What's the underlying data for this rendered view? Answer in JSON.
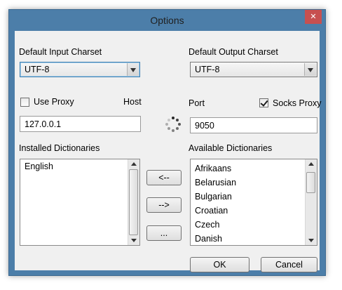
{
  "window": {
    "title": "Options",
    "close_glyph": "✕"
  },
  "input_charset": {
    "label": "Default Input Charset",
    "value": "UTF-8"
  },
  "output_charset": {
    "label": "Default Output Charset",
    "value": "UTF-8"
  },
  "proxy": {
    "use_proxy_label": "Use Proxy",
    "use_proxy_checked": false,
    "host_label": "Host",
    "host_value": "127.0.0.1",
    "port_label": "Port",
    "port_value": "9050",
    "socks_label": "Socks Proxy",
    "socks_checked": true
  },
  "installed": {
    "label": "Installed Dictionaries",
    "items": [
      "English"
    ]
  },
  "available": {
    "label": "Available Dictionaries",
    "items": [
      "Afrikaans",
      "Belarusian",
      "Bulgarian",
      "Croatian",
      "Czech",
      "Danish"
    ]
  },
  "transfer_buttons": {
    "add": "<--",
    "remove": "-->",
    "more": "..."
  },
  "footer": {
    "ok": "OK",
    "cancel": "Cancel"
  },
  "colors": {
    "frame": "#4c7ea9",
    "close": "#c75050",
    "client": "#f0f0f0"
  },
  "icons": {
    "spinner": "loading-spinner-icon",
    "close": "close-icon"
  }
}
